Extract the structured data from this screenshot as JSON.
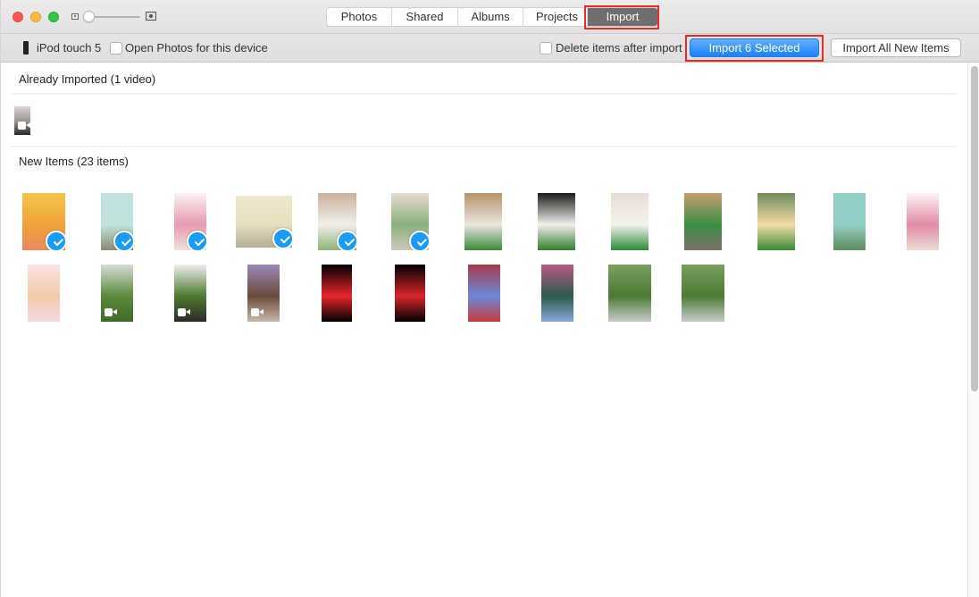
{
  "window": {
    "title_tabs": [
      {
        "label": "Photos",
        "active": false
      },
      {
        "label": "Shared",
        "active": false
      },
      {
        "label": "Albums",
        "active": false
      },
      {
        "label": "Projects",
        "active": false
      },
      {
        "label": "Import",
        "active": true
      }
    ],
    "accent_color": "#1d82fb",
    "highlight_color": "#ee2a24"
  },
  "toolbar": {
    "device_name": "iPod touch 5",
    "open_photos_label": "Open Photos for this device",
    "open_photos_checked": false,
    "delete_after_import_label": "Delete items after import",
    "delete_after_import_checked": false,
    "import_selected_label": "Import 6 Selected",
    "import_all_label": "Import All New Items"
  },
  "already_imported": {
    "header": "Already Imported (1 video)",
    "items": [
      {
        "kind": "video",
        "colors": [
          "#d8d4d2",
          "#9a908e",
          "#2a2624"
        ]
      }
    ]
  },
  "new_items": {
    "header": "New Items (23 items)",
    "items": [
      {
        "kind": "photo",
        "selected": true,
        "colors": [
          "#f3c64a",
          "#f0a23a",
          "#e88a62"
        ]
      },
      {
        "kind": "photo",
        "selected": true,
        "colors": [
          "#bfe4df",
          "#bfe4df",
          "#8a8a70"
        ]
      },
      {
        "kind": "photo",
        "selected": true,
        "colors": [
          "#fbf3f2",
          "#e79ab0",
          "#efe3dc"
        ]
      },
      {
        "kind": "photo",
        "selected": true,
        "colors": [
          "#efe8cc",
          "#e6dfc0",
          "#b4ad98"
        ]
      },
      {
        "kind": "photo",
        "selected": true,
        "colors": [
          "#c9b19a",
          "#f2efe9",
          "#8fb17a"
        ]
      },
      {
        "kind": "photo",
        "selected": true,
        "colors": [
          "#e7dcd2",
          "#8ab07a",
          "#d0c7bf"
        ]
      },
      {
        "kind": "photo",
        "selected": false,
        "colors": [
          "#b8926a",
          "#eae6e0",
          "#3a8a3a"
        ]
      },
      {
        "kind": "photo",
        "selected": false,
        "colors": [
          "#1b1b1b",
          "#f2f0ea",
          "#2f7f2f"
        ]
      },
      {
        "kind": "photo",
        "selected": false,
        "colors": [
          "#e8dcd2",
          "#f5f2ee",
          "#2d8a3a"
        ]
      },
      {
        "kind": "photo",
        "selected": false,
        "colors": [
          "#c79c6e",
          "#3a8f44",
          "#7b7068"
        ]
      },
      {
        "kind": "photo",
        "selected": false,
        "colors": [
          "#6f8a5e",
          "#f3dca4",
          "#3a8a3a"
        ]
      },
      {
        "kind": "photo",
        "selected": false,
        "colors": [
          "#93cfc6",
          "#93cfc6",
          "#5f8a5a"
        ]
      },
      {
        "kind": "photo",
        "selected": false,
        "colors": [
          "#fbf5f3",
          "#e38aa5",
          "#e9dcd4"
        ]
      },
      {
        "kind": "photo",
        "selected": false,
        "colors": [
          "#fbe3e6",
          "#f4c9a8",
          "#f3dade"
        ]
      },
      {
        "kind": "video",
        "selected": false,
        "colors": [
          "#d8dcd6",
          "#5b8a3a",
          "#3f6a2a"
        ]
      },
      {
        "kind": "video",
        "selected": false,
        "colors": [
          "#eeeeee",
          "#4f7a30",
          "#2a2a2a"
        ]
      },
      {
        "kind": "video",
        "selected": false,
        "colors": [
          "#9a8bb8",
          "#6a4a3a",
          "#c8b8a8"
        ]
      },
      {
        "kind": "photo",
        "selected": false,
        "colors": [
          "#000000",
          "#e8262a",
          "#000000"
        ]
      },
      {
        "kind": "photo",
        "selected": false,
        "colors": [
          "#000000",
          "#d8262a",
          "#000000"
        ]
      },
      {
        "kind": "photo",
        "selected": false,
        "colors": [
          "#a63a4a",
          "#6a8ad8",
          "#c83a3a"
        ]
      },
      {
        "kind": "photo",
        "selected": false,
        "colors": [
          "#b85a8a",
          "#2a5a4a",
          "#8aa8d8"
        ]
      },
      {
        "kind": "photo",
        "selected": false,
        "colors": [
          "#7aa060",
          "#4a7a34",
          "#c8ccc8"
        ]
      },
      {
        "kind": "photo",
        "selected": false,
        "colors": [
          "#7aa060",
          "#4a7a34",
          "#c8ccc8"
        ]
      }
    ]
  },
  "scrollbar": {
    "position": 0.0,
    "visible_fraction": 0.62
  }
}
